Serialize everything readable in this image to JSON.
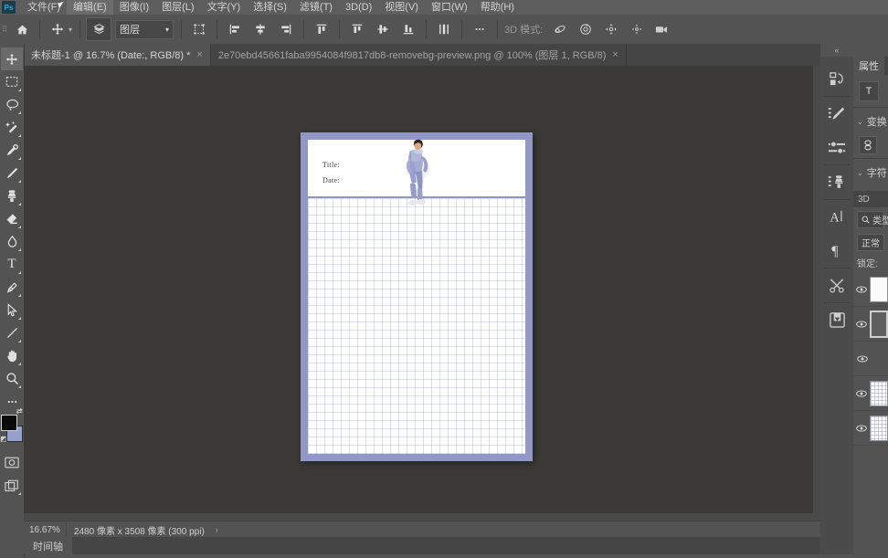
{
  "app": {
    "name": "Adobe Photoshop",
    "logo_text": "Ps",
    "accent_color": "#31a8e0",
    "chrome_bg": "#535353",
    "canvas_bg": "#3b3a36"
  },
  "menubar": {
    "items": [
      {
        "label": "文件(F)",
        "highlighted": false
      },
      {
        "label": "编辑(E)",
        "highlighted": true
      },
      {
        "label": "图像(I)",
        "highlighted": false
      },
      {
        "label": "图层(L)",
        "highlighted": false
      },
      {
        "label": "文字(Y)",
        "highlighted": false
      },
      {
        "label": "选择(S)",
        "highlighted": false
      },
      {
        "label": "滤镜(T)",
        "highlighted": false
      },
      {
        "label": "3D(D)",
        "highlighted": false
      },
      {
        "label": "视图(V)",
        "highlighted": false
      },
      {
        "label": "窗口(W)",
        "highlighted": false
      },
      {
        "label": "帮助(H)",
        "highlighted": false
      }
    ]
  },
  "options_bar": {
    "home_icon": "home-icon",
    "tool_icon": "move-tool-icon",
    "tool_caret": "▾",
    "auto_select_icon": "auto-select-layers-icon",
    "layer_select_value": "图层",
    "layer_select_caret": "▾",
    "transform_controls_icon": "show-transform-controls-icon",
    "align_left_icon": "align-left-edges-icon",
    "align_hcenter_icon": "align-horizontal-centers-icon",
    "align_right_icon": "align-right-edges-icon",
    "align_top_icon": "align-top-edges-icon",
    "distribute_top_icon": "distribute-top-edges-icon",
    "distribute_vcenter_icon": "distribute-vertical-centers-icon",
    "distribute_bottom_icon": "distribute-bottom-edges-icon",
    "distribute_spacing_icon": "distribute-spacing-icon",
    "more_icon": "more-options-icon",
    "threed_mode_label": "3D 模式:",
    "threed_orbit_icon": "3d-orbit-icon",
    "threed_roll_icon": "3d-roll-icon",
    "threed_pan_icon": "3d-pan-icon",
    "threed_slide_icon": "3d-slide-icon",
    "threed_camera_icon": "3d-camera-icon"
  },
  "tabs": {
    "collapse_icon": "«",
    "items": [
      {
        "label": "未标题-1 @ 16.7% (Date:, RGB/8) *",
        "active": true,
        "close": "×"
      },
      {
        "label": "2e70ebd45661faba9954084f9817db8-removebg-preview.png @ 100% (图层 1, RGB/8)",
        "active": false,
        "close": "×"
      }
    ]
  },
  "toolbar": {
    "tools": [
      {
        "name": "move-tool-icon",
        "glyph": "✥",
        "active": true,
        "has_corner": false
      },
      {
        "name": "rectangular-marquee-tool-icon",
        "glyph": "▢",
        "active": false,
        "has_corner": true
      },
      {
        "name": "lasso-tool-icon",
        "glyph": "◯",
        "active": false,
        "has_corner": true
      },
      {
        "name": "quick-selection-tool-icon",
        "glyph": "✦",
        "active": false,
        "has_corner": true
      },
      {
        "name": "eyedropper-tool-icon",
        "glyph": "⌖",
        "active": false,
        "has_corner": true
      },
      {
        "name": "brush-tool-icon",
        "glyph": "✎",
        "active": false,
        "has_corner": true
      },
      {
        "name": "clone-stamp-tool-icon",
        "glyph": "⎈",
        "active": false,
        "has_corner": true
      },
      {
        "name": "eraser-tool-icon",
        "glyph": "◣",
        "active": false,
        "has_corner": true
      },
      {
        "name": "blur-tool-icon",
        "glyph": "◌",
        "active": false,
        "has_corner": true
      },
      {
        "name": "type-tool-icon",
        "glyph": "T",
        "active": false,
        "has_corner": true
      },
      {
        "name": "pen-tool-icon",
        "glyph": "✒",
        "active": false,
        "has_corner": true
      },
      {
        "name": "path-selection-tool-icon",
        "glyph": "➤",
        "active": false,
        "has_corner": true
      },
      {
        "name": "line-tool-icon",
        "glyph": "╱",
        "active": false,
        "has_corner": true
      },
      {
        "name": "hand-tool-icon",
        "glyph": "✋",
        "active": false,
        "has_corner": true
      },
      {
        "name": "zoom-tool-icon",
        "glyph": "⌕",
        "active": false,
        "has_corner": true
      },
      {
        "name": "edit-toolbar-icon",
        "glyph": "⋯",
        "active": false,
        "has_corner": true
      }
    ],
    "swatches": {
      "foreground_color": "#0a0a0a",
      "background_color": "#9aa0ce",
      "swap_icon": "swap-colors-icon",
      "default_icon": "default-colors-icon"
    },
    "quick_mask_icon": "quick-mask-mode-icon",
    "screen_mode_icon": "screen-mode-icon"
  },
  "document": {
    "header": {
      "title_label": "Title:",
      "date_label": "Date:"
    },
    "page_border_color": "#9197c6",
    "grid_color": "#969bc3",
    "image_layer_name": "person-photo"
  },
  "status_bar": {
    "zoom": "16.67%",
    "doc_size": "2480 像素 x 3508 像素 (300 ppi)",
    "caret": "›"
  },
  "timeline": {
    "tab_label": "时间轴"
  },
  "right_dock": {
    "collapse_icon": "«",
    "rail_icons": [
      {
        "name": "history-icon",
        "glyph": "⟲"
      },
      {
        "name": "adjustments-icon",
        "glyph": "✎"
      },
      {
        "name": "sliders-icon",
        "glyph": "⚌"
      },
      {
        "name": "actions-icon",
        "glyph": "⎈"
      },
      {
        "name": "character-panel-icon",
        "glyph": "A"
      },
      {
        "name": "paragraph-panel-icon",
        "glyph": "¶"
      },
      {
        "name": "tools-preset-icon",
        "glyph": "✂"
      },
      {
        "name": "libraries-icon",
        "glyph": "▣"
      }
    ],
    "properties_panel": {
      "tab_label": "属性",
      "type_icon": "text-layer-type-icon",
      "type_icon_glyph": "T",
      "transform_section_label": "变换",
      "link_icon": "link-width-height-icon",
      "character_section_label": "字符"
    },
    "layers_panel": {
      "threed_tab_label": "3D",
      "filter_icon": "search-icon",
      "filter_label": "类型",
      "blend_mode": "正常",
      "lock_label": "锁定:",
      "layers": [
        {
          "name": "layer-row",
          "visible_icon": "eye-icon",
          "thumb_kind": "plain"
        },
        {
          "name": "layer-row",
          "visible_icon": "eye-icon",
          "thumb_kind": "outline"
        },
        {
          "name": "layer-row",
          "visible_icon": "eye-icon",
          "thumb_kind": "none"
        },
        {
          "name": "layer-row",
          "visible_icon": "eye-icon",
          "thumb_kind": "grid"
        },
        {
          "name": "layer-row",
          "visible_icon": "eye-icon",
          "thumb_kind": "grid"
        }
      ]
    }
  }
}
